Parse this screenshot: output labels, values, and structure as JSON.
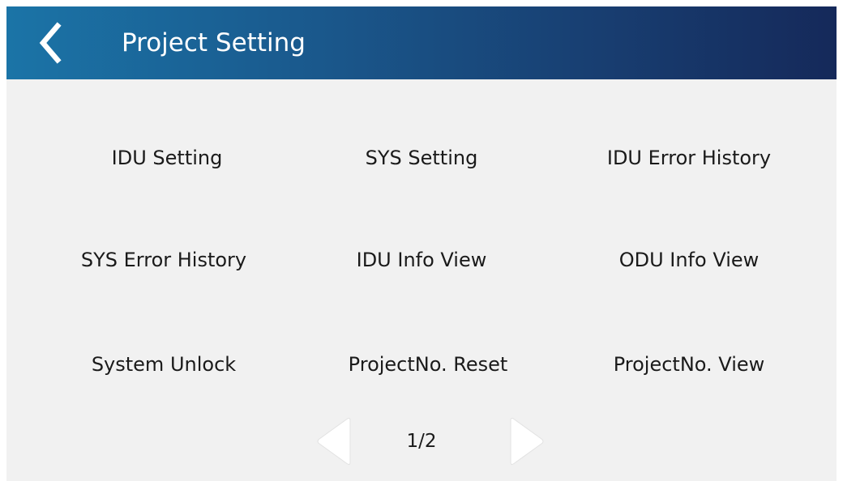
{
  "header": {
    "title": "Project Setting",
    "back_icon": "chevron-left-icon"
  },
  "menu": {
    "items": [
      {
        "label": "IDU Setting"
      },
      {
        "label": "SYS Setting"
      },
      {
        "label": "IDU Error History"
      },
      {
        "label": "SYS Error History"
      },
      {
        "label": "IDU Info View"
      },
      {
        "label": "ODU Info View"
      },
      {
        "label": "System Unlock"
      },
      {
        "label": "ProjectNo. Reset"
      },
      {
        "label": "ProjectNo. View"
      }
    ]
  },
  "pager": {
    "page_indicator": "1/2",
    "prev_icon": "triangle-left-icon",
    "next_icon": "triangle-right-icon"
  },
  "colors": {
    "header_gradient_start": "#1b74a7",
    "header_gradient_end": "#15295a",
    "background": "#f1f1f1",
    "text": "#1a1a1a"
  }
}
